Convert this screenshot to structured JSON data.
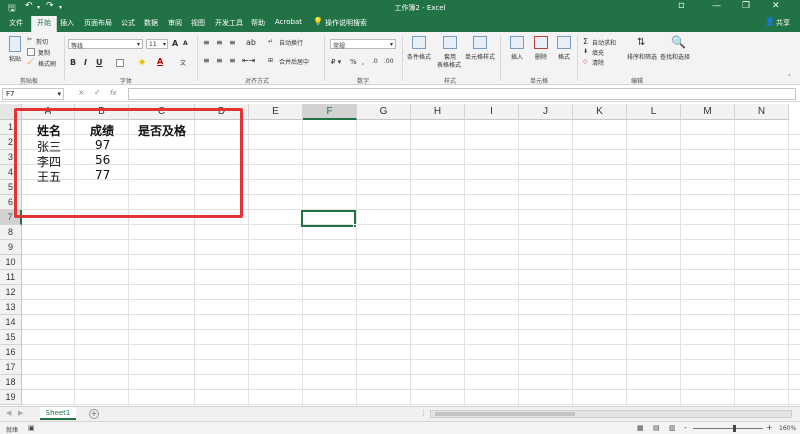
{
  "window": {
    "title": "工作簿2 - Excel",
    "share": "共享"
  },
  "tabs": [
    "文件",
    "开始",
    "插入",
    "页面布局",
    "公式",
    "数据",
    "审阅",
    "视图",
    "开发工具",
    "帮助",
    "Acrobat"
  ],
  "active_tab": "开始",
  "tell_me": "操作说明搜索",
  "ribbon": {
    "clipboard": {
      "paste": "粘贴",
      "cut": "剪切",
      "copy": "复制",
      "format_painter": "格式刷",
      "label": "剪贴板"
    },
    "font": {
      "name": "等线",
      "size": "11",
      "label": "字体"
    },
    "alignment": {
      "wrap": "自动换行",
      "merge": "合并后居中",
      "label": "对齐方式"
    },
    "number": {
      "format": "常规",
      "label": "数字"
    },
    "styles": {
      "conditional": "条件格式",
      "table": [
        "套用",
        "表格格式"
      ],
      "cell_styles": "单元格样式",
      "label": "样式"
    },
    "cells": {
      "insert": "插入",
      "delete": "删除",
      "format": "格式",
      "label": "单元格"
    },
    "editing": {
      "autosum": "自动求和",
      "fill": "填充",
      "clear": "清除",
      "sort": "排序和筛选",
      "find": "查找和选择",
      "label": "编辑"
    }
  },
  "formula_bar": {
    "name_box": "F7",
    "cancel": "×",
    "enter": "✓",
    "fx": "fx",
    "value": ""
  },
  "grid": {
    "columns": [
      "A",
      "B",
      "C",
      "D",
      "E",
      "F",
      "G",
      "H",
      "I",
      "J",
      "K",
      "L",
      "M",
      "N"
    ],
    "selected_column": "F",
    "rows": [
      "1",
      "2",
      "3",
      "4",
      "5",
      "6",
      "7",
      "8",
      "9",
      "10",
      "11",
      "12",
      "13",
      "14",
      "15",
      "16",
      "17",
      "18",
      "19"
    ],
    "selected_row": "7",
    "selected_cell": "F7",
    "headers": {
      "a1": "姓名",
      "b1": "成绩",
      "c1": "是否及格"
    },
    "data_rows": [
      {
        "name": "张三",
        "score": "97"
      },
      {
        "name": "李四",
        "score": "56"
      },
      {
        "name": "王五",
        "score": "77"
      }
    ]
  },
  "sheets": {
    "tabs": [
      "Sheet1"
    ],
    "add": "+"
  },
  "status": {
    "ready": "就绪",
    "zoom": "160%",
    "zoom_out": "-",
    "zoom_in": "+"
  },
  "colors": {
    "accent": "#217346",
    "highlight": "#e13535"
  }
}
